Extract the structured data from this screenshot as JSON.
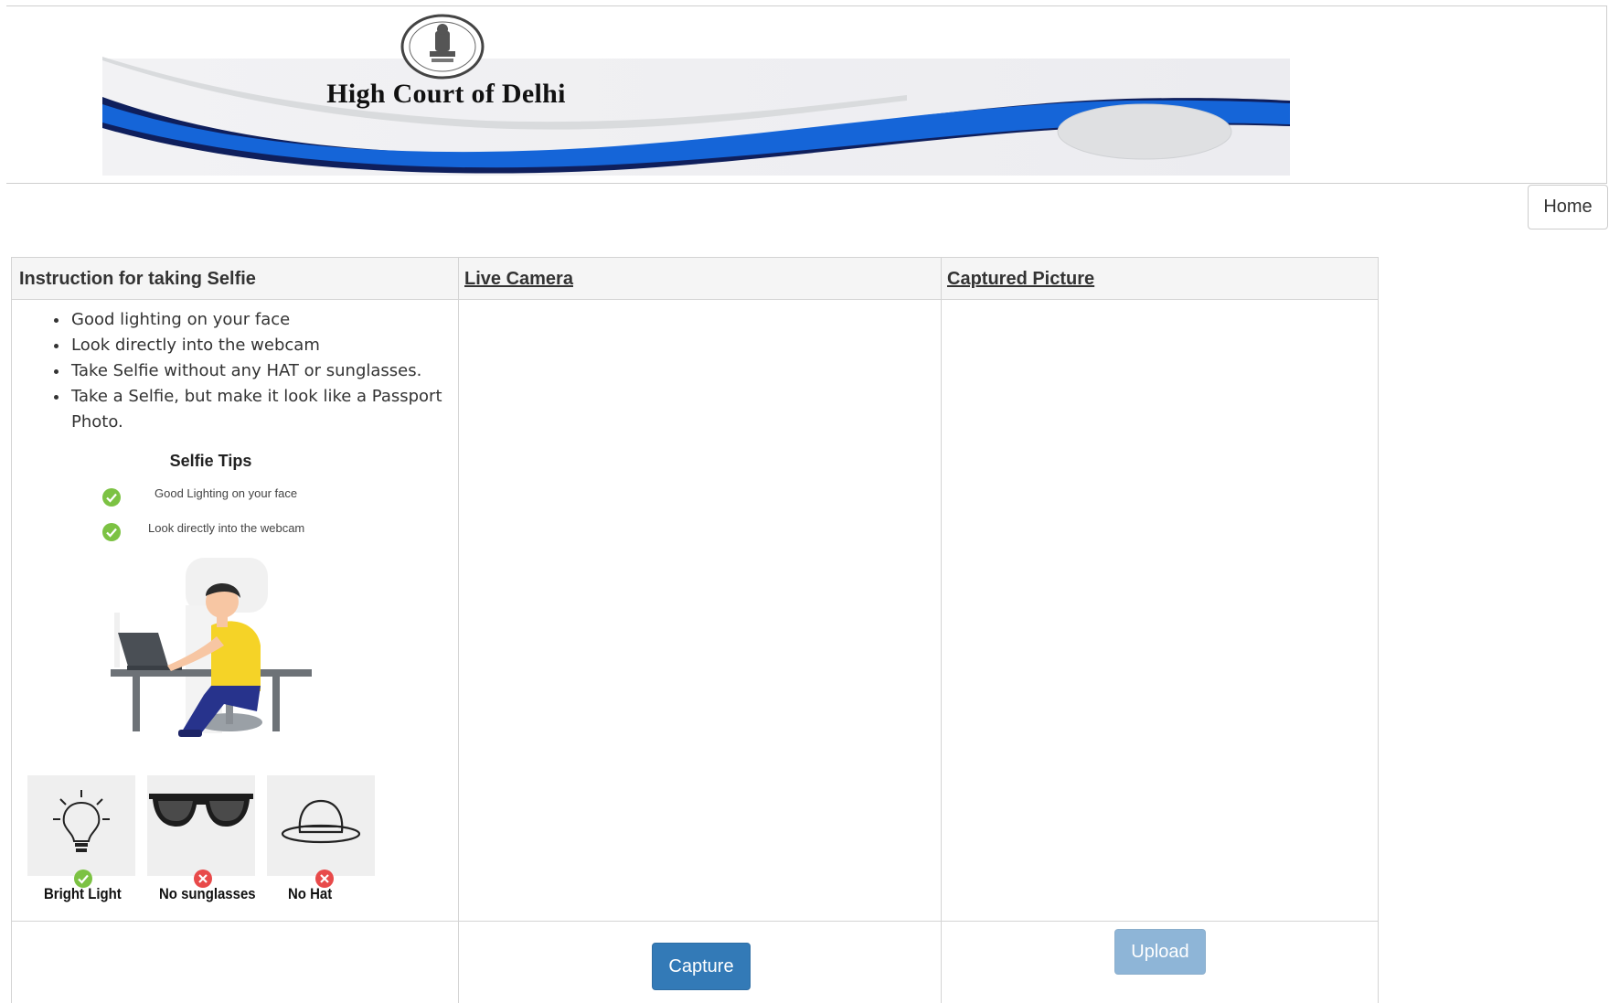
{
  "header": {
    "court_name": "High Court of Delhi",
    "emblem_icon": "state-emblem-icon",
    "home_label": "Home"
  },
  "table": {
    "headers": {
      "instructions": "Instruction for taking Selfie",
      "live_camera": "Live Camera",
      "captured_picture": "Captured Picture"
    },
    "instructions": [
      "Good lighting on your face",
      "Look directly into the webcam",
      "Take Selfie without any HAT or sunglasses.",
      "Take a Selfie, but make it look like a Passport Photo."
    ],
    "selfie_tips": {
      "title": "Selfie Tips",
      "items": [
        "Good Lighting on your face",
        "Look directly into the webcam"
      ]
    },
    "tiles": [
      {
        "label": "Bright Light",
        "icon": "light-bulb-icon",
        "status": "allowed"
      },
      {
        "label": "No sunglasses",
        "icon": "sunglasses-icon",
        "status": "not-allowed"
      },
      {
        "label": "No Hat",
        "icon": "hat-icon",
        "status": "not-allowed"
      }
    ]
  },
  "buttons": {
    "capture": "Capture",
    "upload": "Upload"
  },
  "colors": {
    "primary_button": "#337ab7",
    "check_green": "#7cc243",
    "cross_red": "#e84a4a",
    "banner_blue": "#1565d8"
  }
}
